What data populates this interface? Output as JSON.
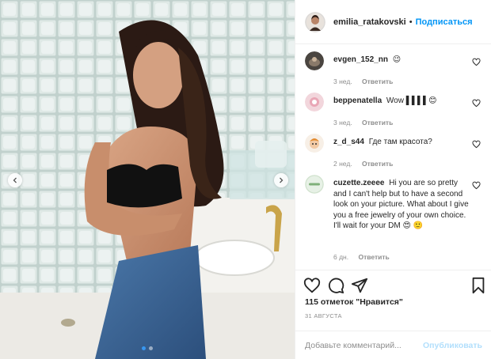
{
  "post": {
    "author": "emilia_ratakovski",
    "separator": "•",
    "follow_label": "Подписаться",
    "likes_text": "115 отметок \"Нравится\"",
    "date": "31 августа"
  },
  "comments": [
    {
      "user": "evgen_152_nn",
      "text": "😉",
      "time": "3 нед.",
      "reply_label": "Ответить",
      "avatar_icon": "dark-avatar"
    },
    {
      "user": "beppenatella",
      "text": "Wow ▌▌▌▌😊",
      "time": "3 нед.",
      "reply_label": "Ответить",
      "avatar_icon": "pink-avatar"
    },
    {
      "user": "z_d_s44",
      "text": "Где там красота?",
      "time": "2 нед.",
      "reply_label": "Ответить",
      "avatar_icon": "cartoon-avatar"
    },
    {
      "user": "cuzette.zeeee",
      "text": "Hi you are so pretty and I can't help but to have a second look on your picture. What about I give you a free jewelry of your own choice. I'll wait for your DM 😍 🙂",
      "time": "6 дн.",
      "reply_label": "Ответить",
      "avatar_icon": "green-logo-avatar"
    }
  ],
  "comment_box": {
    "placeholder": "Добавьте комментарий...",
    "post_label": "Опубликовать"
  },
  "icons": {
    "like": "heart-icon",
    "comment": "comment-bubble-icon",
    "share": "paper-plane-icon",
    "save": "bookmark-icon",
    "carousel_prev": "chevron-left-icon",
    "carousel_next": "chevron-right-icon"
  },
  "colors": {
    "accent": "#0095f6",
    "post_disabled": "#b2dffc",
    "muted": "#8e8e8e",
    "text": "#262626",
    "border": "#efefef"
  },
  "carousel": {
    "total": 2,
    "current": 1
  }
}
